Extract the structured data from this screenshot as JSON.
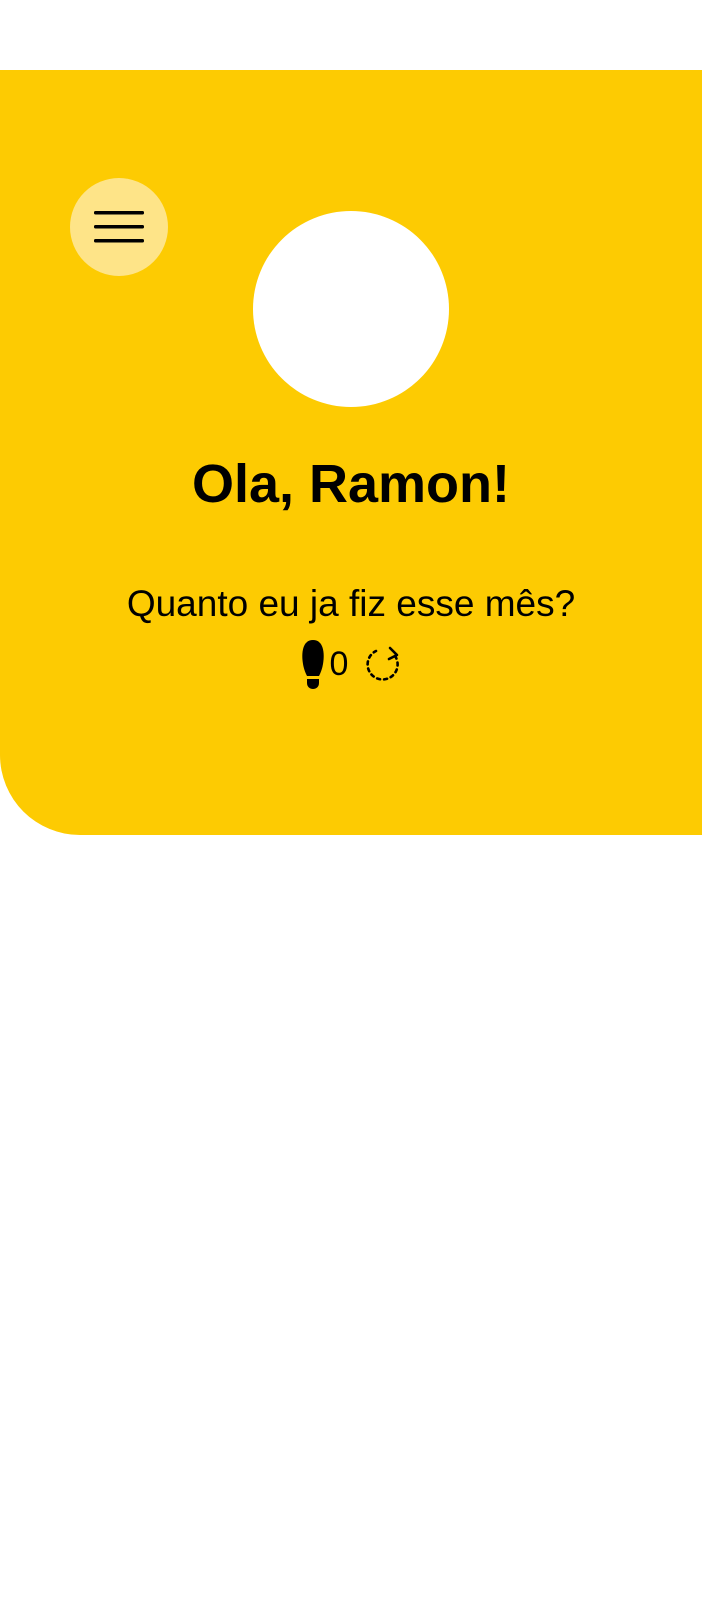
{
  "header": {
    "background_color": "#FDCB02",
    "menu_icon": "hamburger-menu-icon",
    "menu_button_color": "#FEE488",
    "greeting": "Ola, Ramon!",
    "question": "Quanto eu ja fiz esse mês?",
    "steps_icon": "footprints-icon",
    "steps_count": "0",
    "refresh_icon": "refresh-icon"
  }
}
